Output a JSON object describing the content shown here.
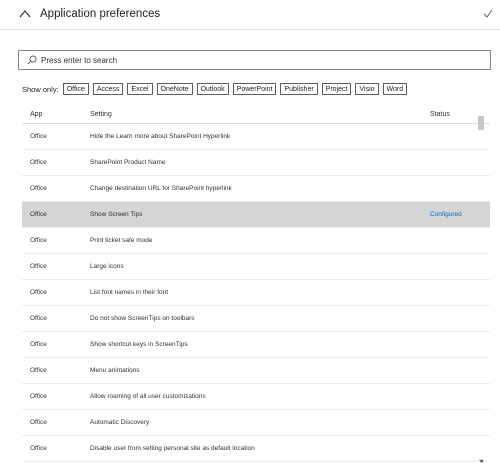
{
  "header": {
    "title": "Application preferences"
  },
  "search": {
    "placeholder": "Press enter to search"
  },
  "filter": {
    "label": "Show only:",
    "apps": [
      "Office",
      "Access",
      "Excel",
      "OneNote",
      "Outlook",
      "PowerPoint",
      "Publisher",
      "Project",
      "Visio",
      "Word"
    ]
  },
  "table": {
    "columns": {
      "app": "App",
      "setting": "Setting",
      "status": "Status"
    },
    "rows": [
      {
        "app": "Office",
        "setting": "Hide the Learn more about SharePoint Hyperlink",
        "status": ""
      },
      {
        "app": "Office",
        "setting": "SharePoint Product Name",
        "status": ""
      },
      {
        "app": "Office",
        "setting": "Change destination URL for SharePoint hyperlink",
        "status": ""
      },
      {
        "app": "Office",
        "setting": "Show Screen Tips",
        "status": "Configured",
        "selected": true
      },
      {
        "app": "Office",
        "setting": "Print ticket safe mode",
        "status": ""
      },
      {
        "app": "Office",
        "setting": "Large icons",
        "status": ""
      },
      {
        "app": "Office",
        "setting": "List font names in their font",
        "status": ""
      },
      {
        "app": "Office",
        "setting": "Do not show ScreenTips on toolbars",
        "status": ""
      },
      {
        "app": "Office",
        "setting": "Show shortcut keys in ScreenTips",
        "status": ""
      },
      {
        "app": "Office",
        "setting": "Menu animations",
        "status": ""
      },
      {
        "app": "Office",
        "setting": "Allow roaming of all user customizations",
        "status": ""
      },
      {
        "app": "Office",
        "setting": "Automatic Discovery",
        "status": ""
      },
      {
        "app": "Office",
        "setting": "Disable user from setting personal site as default location",
        "status": ""
      }
    ]
  },
  "colors": {
    "accent": "#0a6ab8",
    "selected_row": "#d5d5d5"
  },
  "icons": {
    "collapse": "chevron-up-icon",
    "confirm": "checkmark-icon",
    "search": "search-icon"
  }
}
